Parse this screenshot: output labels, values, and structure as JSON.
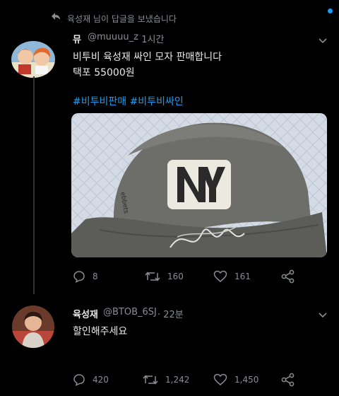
{
  "reply_banner": {
    "text": "육성재 님이 답글을 보냈습니다"
  },
  "tweet": {
    "name": "뮤",
    "handle": "@muuuu_z",
    "time": "· 1시간",
    "lines": [
      "비투비 육성재 싸인 모자 판매합니다",
      "택포 55000원"
    ],
    "hashtags": "#비투비판매 #비투비싸인",
    "image_text": "NY",
    "stats": {
      "replies": "8",
      "retweets": "160",
      "likes": "161"
    }
  },
  "reply": {
    "name": "육성재",
    "handle": "@BTOB_6SJ",
    "time": "· 22분",
    "text": "할인해주세요",
    "stats": {
      "replies": "420",
      "retweets": "1,242",
      "likes": "1,450"
    }
  },
  "icons": {
    "reply": "reply-icon",
    "comment": "comment-icon",
    "retweet": "retweet-icon",
    "like": "heart-icon",
    "share": "share-icon",
    "more": "chevron-down-icon"
  },
  "colors": {
    "background": "#000000",
    "accent": "#1d9bf0",
    "muted": "#8a8d91",
    "text": "#e7e9ea"
  }
}
